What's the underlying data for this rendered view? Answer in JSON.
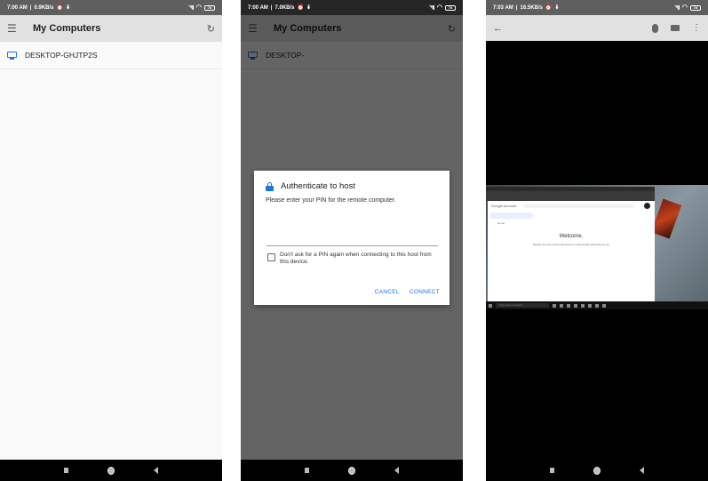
{
  "screens": [
    {
      "status_bar": {
        "time": "7:00 AM",
        "speed": "0.9KB/s",
        "battery": "78"
      },
      "app_bar": {
        "title": "My Computers"
      },
      "hosts": [
        {
          "name": "DESKTOP-GHJTP2S"
        }
      ]
    },
    {
      "status_bar": {
        "time": "7:00 AM",
        "speed": "7.0KB/s",
        "battery": "78"
      },
      "app_bar": {
        "title": "My Computers"
      },
      "hosts": [
        {
          "name": "DESKTOP-"
        }
      ],
      "dialog": {
        "title": "Authenticate to host",
        "message": "Please enter your PIN for the remote computer.",
        "pin_value": "",
        "pin_placeholder": "",
        "checkbox_label": "Don't ask for a PIN again when connecting to this host from this device.",
        "checkbox_checked": false,
        "cancel_label": "CANCEL",
        "connect_label": "CONNECT"
      }
    },
    {
      "status_bar": {
        "time": "7:03 AM",
        "speed": "16.5KB/s",
        "battery": "78"
      },
      "toolbar": {
        "back_icon": "arrow-left",
        "mouse_icon": "mouse",
        "keyboard_icon": "keyboard",
        "more_icon": "more-vertical"
      },
      "remote_desktop": {
        "browser_brand": "Google Account",
        "sidebar_item": "Home",
        "welcome": "Welcome,",
        "subtitle": "Manage your info, privacy and security to make Google work better for you",
        "taskbar_search": "Type here to search"
      }
    }
  ],
  "nav_bar": {
    "recent_icon": "square",
    "home_icon": "circle",
    "back_icon": "triangle-left"
  },
  "colors": {
    "accent": "#1a73e8",
    "appbar": "#e1e1e1",
    "statusbar": "#5f5f5f"
  }
}
